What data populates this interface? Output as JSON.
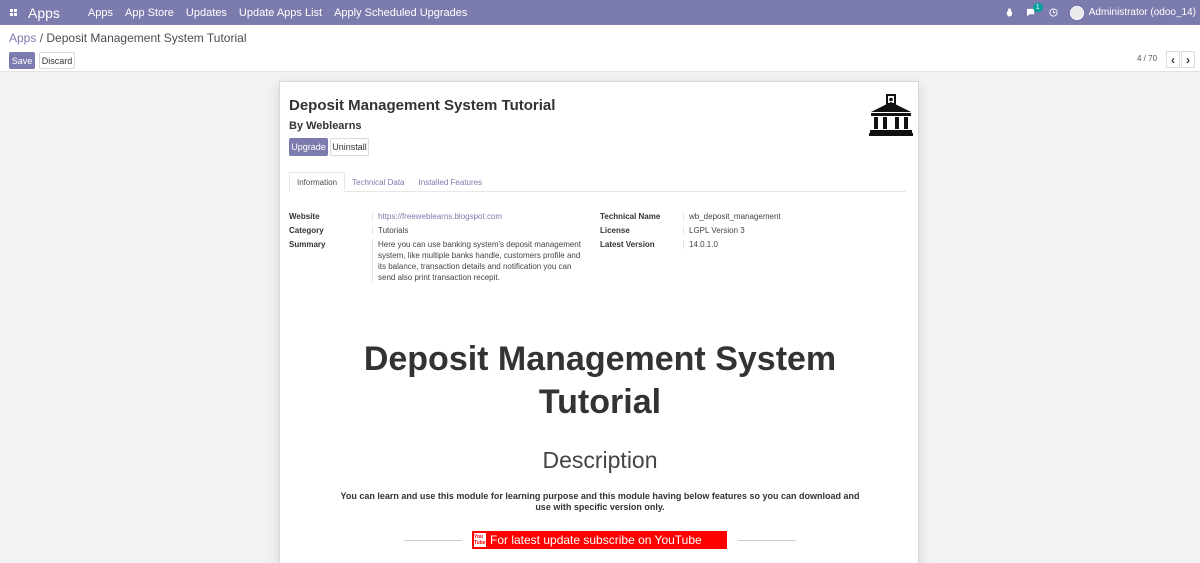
{
  "navbar": {
    "brand": "Apps",
    "menu": [
      "Apps",
      "App Store",
      "Updates",
      "Update Apps List",
      "Apply Scheduled Upgrades"
    ],
    "message_count": "1",
    "user": "Administrator (odoo_14)"
  },
  "breadcrumb": {
    "parent": "Apps",
    "separator": "/",
    "current": "Deposit Management System Tutorial"
  },
  "actions": {
    "save": "Save",
    "discard": "Discard"
  },
  "pager": {
    "value": "4 / 70"
  },
  "module": {
    "title": "Deposit Management System Tutorial",
    "author": "By Weblearns",
    "upgrade": "Upgrade",
    "uninstall": "Uninstall",
    "tabs": [
      "Information",
      "Technical Data",
      "Installed Features"
    ],
    "info": {
      "website_label": "Website",
      "website": "https://freeweblearns.blogspot.com",
      "category_label": "Category",
      "category": "Tutorials",
      "summary_label": "Summary",
      "summary": "Here you can use banking system's deposit management system, like multiple banks handle, customers profile and its balance, transaction details and notification you can send also print transaction recepit.",
      "technical_name_label": "Technical Name",
      "technical_name": "wb_deposit_management",
      "license_label": "License",
      "license": "LGPL Version 3",
      "version_label": "Latest Version",
      "version": "14.0.1.0"
    },
    "description": {
      "title": "Deposit Management System Tutorial",
      "heading": "Description",
      "text": "You can learn and use this module for learning purpose and this module having below features so you can download and use with specific version only.",
      "youtube_logo": "You Tube",
      "youtube_banner": "For latest update subscribe on YouTube"
    }
  },
  "colors": {
    "primary": "#7c7bad",
    "youtube": "#ff0000"
  },
  "icons": [
    "apps-grid-icon",
    "bug-icon",
    "chat-icon",
    "clock-icon",
    "bank-icon",
    "youtube-icon"
  ]
}
